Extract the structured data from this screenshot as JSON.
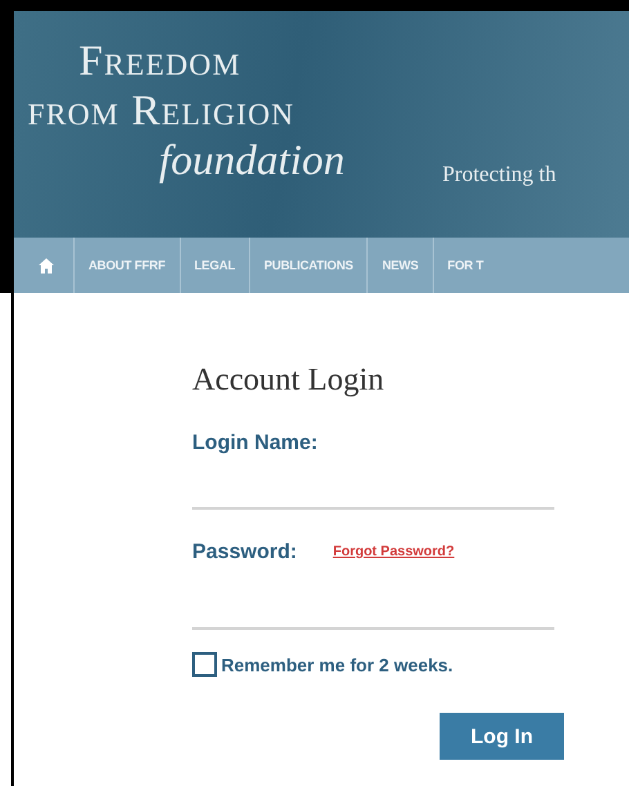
{
  "header": {
    "logo_lines": [
      "Freedom",
      "from Religion"
    ],
    "logo_script": "foundation",
    "tagline": "Protecting th"
  },
  "nav": {
    "items": [
      {
        "label": "ABOUT FFRF",
        "selected": false
      },
      {
        "label": "LEGAL",
        "selected": false
      },
      {
        "label": "PUBLICATIONS",
        "selected": false
      },
      {
        "label": "NEWS",
        "selected": false
      },
      {
        "label": "FOR T",
        "selected": false
      }
    ]
  },
  "login": {
    "title": "Account Login",
    "name_label": "Login Name:",
    "password_label": "Password:",
    "forgot_link": "Forgot Password?",
    "remember": {
      "label": "Remember me for 2 weeks.",
      "checked": false
    },
    "submit": "Log In"
  }
}
